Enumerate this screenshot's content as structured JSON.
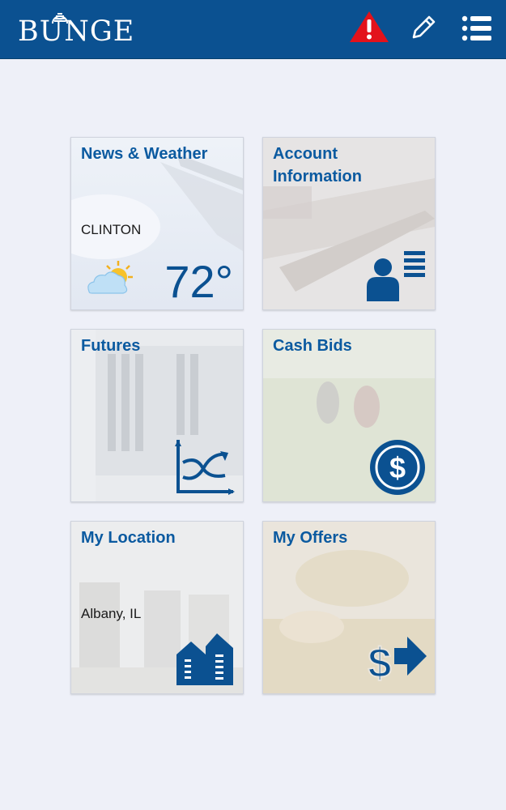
{
  "header": {
    "logo_text": "BUNGE",
    "alert_icon": "warning-triangle-icon",
    "edit_icon": "pencil-icon",
    "menu_icon": "list-menu-icon",
    "brand_color": "#0b5191",
    "alert_color": "#e3121b"
  },
  "tiles": {
    "news": {
      "title": "News & Weather",
      "location": "CLINTON",
      "temperature": "72°",
      "icon": "partly-cloudy-icon"
    },
    "account": {
      "title": "Account Information",
      "icon": "user-profile-icon"
    },
    "futures": {
      "title": "Futures",
      "icon": "chart-trend-icon"
    },
    "cash_bids": {
      "title": "Cash Bids",
      "icon": "dollar-circle-icon"
    },
    "location": {
      "title": "My Location",
      "location": "Albany, IL",
      "icon": "grain-elevator-icon"
    },
    "offers": {
      "title": "My Offers",
      "icon": "dollar-arrow-icon"
    }
  }
}
